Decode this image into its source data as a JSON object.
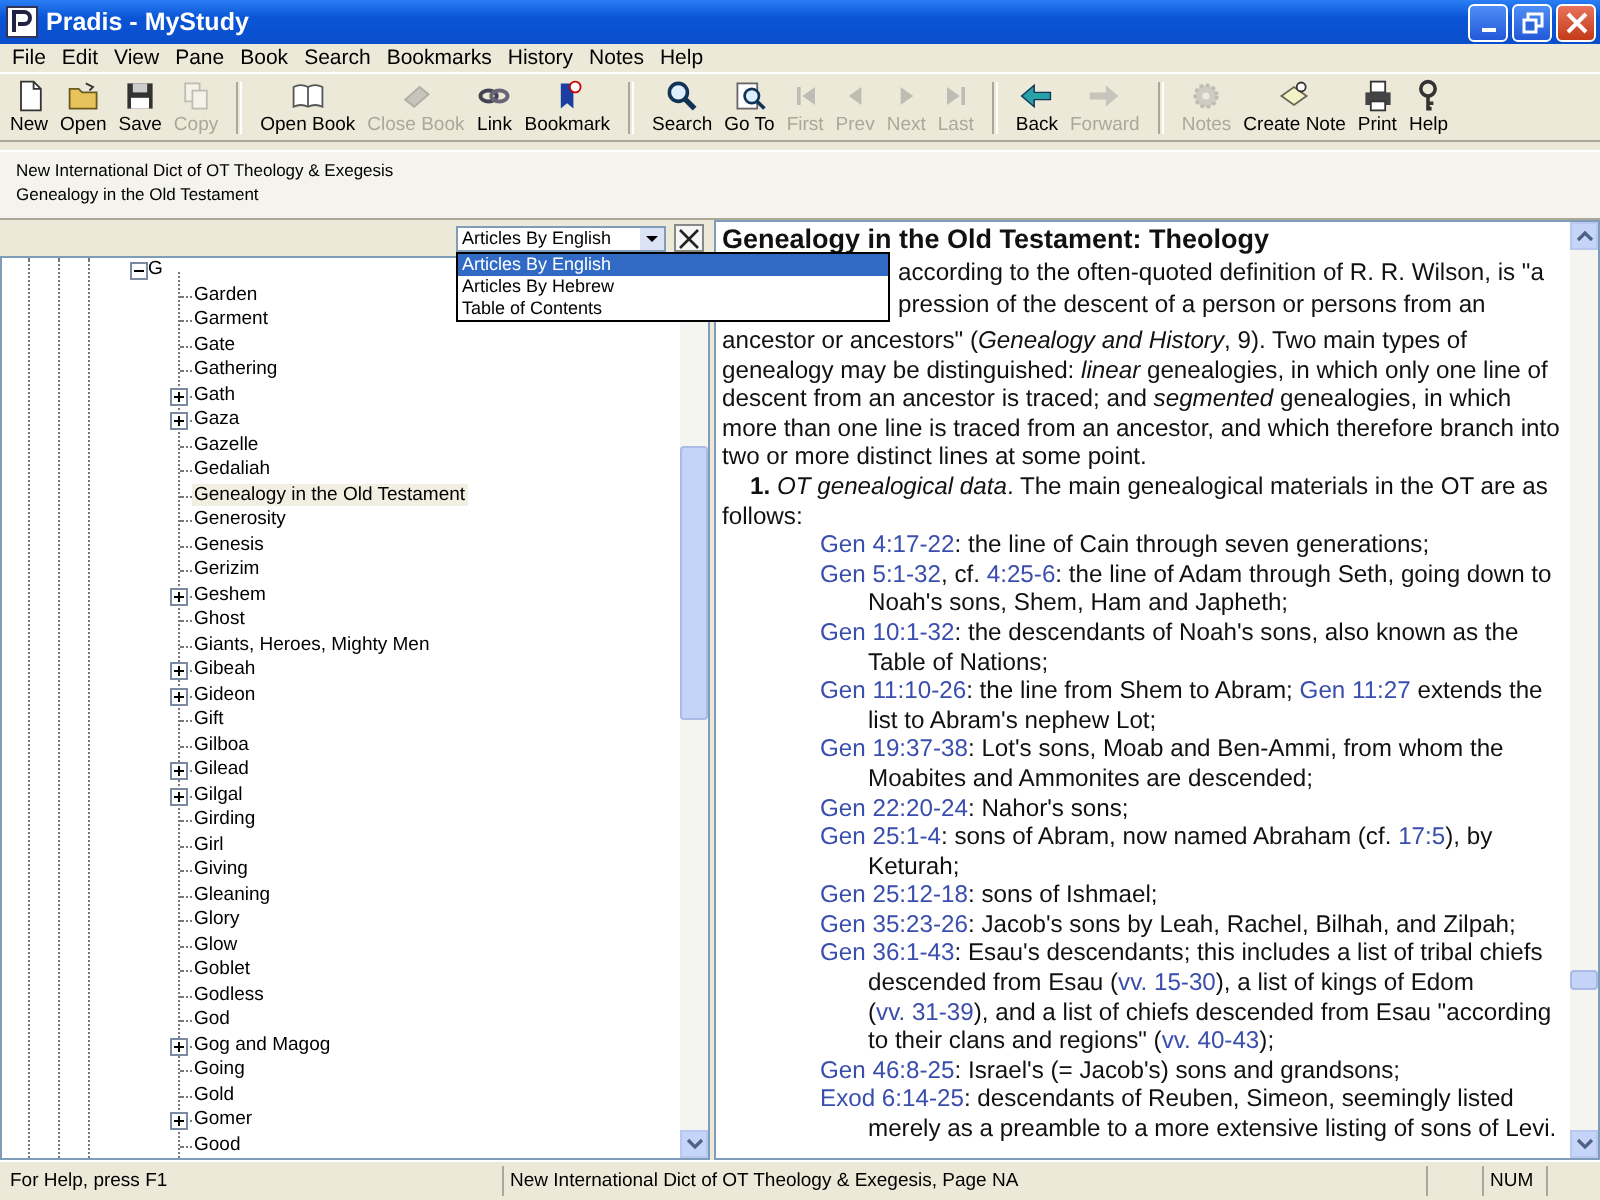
{
  "window": {
    "title": "Pradis - MyStudy"
  },
  "menu": [
    "File",
    "Edit",
    "View",
    "Pane",
    "Book",
    "Search",
    "Bookmarks",
    "History",
    "Notes",
    "Help"
  ],
  "toolbar": [
    [
      {
        "label": "New",
        "disabled": false
      },
      {
        "label": "Open",
        "disabled": false
      },
      {
        "label": "Save",
        "disabled": false
      },
      {
        "label": "Copy",
        "disabled": true
      }
    ],
    [
      {
        "label": "Open Book",
        "disabled": false
      },
      {
        "label": "Close Book",
        "disabled": true
      },
      {
        "label": "Link",
        "disabled": false
      },
      {
        "label": "Bookmark",
        "disabled": false
      }
    ],
    [
      {
        "label": "Search",
        "disabled": false
      },
      {
        "label": "Go To",
        "disabled": false
      },
      {
        "label": "First",
        "disabled": true
      },
      {
        "label": "Prev",
        "disabled": true
      },
      {
        "label": "Next",
        "disabled": true
      },
      {
        "label": "Last",
        "disabled": true
      }
    ],
    [
      {
        "label": "Back",
        "disabled": false
      },
      {
        "label": "Forward",
        "disabled": true
      }
    ],
    [
      {
        "label": "Notes",
        "disabled": true
      },
      {
        "label": "Create Note",
        "disabled": false
      },
      {
        "label": "Print",
        "disabled": false
      },
      {
        "label": "Help",
        "disabled": false
      }
    ]
  ],
  "header": {
    "book": "New International Dict of OT Theology & Exegesis",
    "article": "Genealogy in the Old Testament"
  },
  "index_pane": {
    "view_select": {
      "value": "Articles By English",
      "expanded": true,
      "options": [
        {
          "label": "Articles By English",
          "selected": true
        },
        {
          "label": "Articles By Hebrew",
          "selected": false
        },
        {
          "label": "Table of Contents",
          "selected": false
        }
      ]
    },
    "tree": [
      {
        "label": "G",
        "expanded": true,
        "children": [
          {
            "label": "Garden",
            "kind": "leaf",
            "selected": false
          },
          {
            "label": "Garment",
            "kind": "leaf",
            "selected": false
          },
          {
            "label": "Gate",
            "kind": "leaf",
            "selected": false
          },
          {
            "label": "Gathering",
            "kind": "leaf",
            "selected": false
          },
          {
            "label": "Gath",
            "kind": "branch",
            "selected": false
          },
          {
            "label": "Gaza",
            "kind": "branch",
            "selected": false
          },
          {
            "label": "Gazelle",
            "kind": "leaf",
            "selected": false
          },
          {
            "label": "Gedaliah",
            "kind": "leaf",
            "selected": false
          },
          {
            "label": "Genealogy in the Old Testament",
            "kind": "leaf",
            "selected": true
          },
          {
            "label": "Generosity",
            "kind": "leaf",
            "selected": false
          },
          {
            "label": "Genesis",
            "kind": "leaf",
            "selected": false
          },
          {
            "label": "Gerizim",
            "kind": "leaf",
            "selected": false
          },
          {
            "label": "Geshem",
            "kind": "branch",
            "selected": false
          },
          {
            "label": "Ghost",
            "kind": "leaf",
            "selected": false
          },
          {
            "label": "Giants, Heroes, Mighty Men",
            "kind": "leaf",
            "selected": false
          },
          {
            "label": "Gibeah",
            "kind": "branch",
            "selected": false
          },
          {
            "label": "Gideon",
            "kind": "branch",
            "selected": false
          },
          {
            "label": "Gift",
            "kind": "leaf",
            "selected": false
          },
          {
            "label": "Gilboa",
            "kind": "leaf",
            "selected": false
          },
          {
            "label": "Gilead",
            "kind": "branch",
            "selected": false
          },
          {
            "label": "Gilgal",
            "kind": "branch",
            "selected": false
          },
          {
            "label": "Girding",
            "kind": "leaf",
            "selected": false
          },
          {
            "label": "Girl",
            "kind": "leaf",
            "selected": false
          },
          {
            "label": "Giving",
            "kind": "leaf",
            "selected": false
          },
          {
            "label": "Gleaning",
            "kind": "leaf",
            "selected": false
          },
          {
            "label": "Glory",
            "kind": "leaf",
            "selected": false
          },
          {
            "label": "Glow",
            "kind": "leaf",
            "selected": false
          },
          {
            "label": "Goblet",
            "kind": "leaf",
            "selected": false
          },
          {
            "label": "Godless",
            "kind": "leaf",
            "selected": false
          },
          {
            "label": "God",
            "kind": "leaf",
            "selected": false
          },
          {
            "label": "Gog and Magog",
            "kind": "branch",
            "selected": false
          },
          {
            "label": "Going",
            "kind": "leaf",
            "selected": false
          },
          {
            "label": "Gold",
            "kind": "leaf",
            "selected": false
          },
          {
            "label": "Gomer",
            "kind": "branch",
            "selected": false
          },
          {
            "label": "Good",
            "kind": "leaf",
            "selected": false
          }
        ]
      }
    ]
  },
  "article": {
    "title": "Genealogy in the Old Testament: Theology",
    "intro_visible_lines": [
      "according to the often-quoted definition of R. R. Wilson, is \"a",
      "pression of the descent of a person or persons from an"
    ],
    "intro_rest": "ancestor or ancestors\" (*Genealogy and History*, 9). Two main types of genealogy may be distinguished: *linear* genealogies, in which only one line of descent from an ancestor is traced; and *segmented* genealogies, in which more than one line is traced from an ancestor, and which therefore branch into two or more distinct lines at some point.",
    "section": "**1.** *OT genealogical data*. The main genealogical materials in the OT are as follows:",
    "references": [
      [
        {
          "kind": "ref",
          "text": "Gen 4:17-22"
        },
        {
          "kind": "text",
          "text": ": the line of Cain through seven generations;"
        }
      ],
      [
        {
          "kind": "ref",
          "text": "Gen 5:1-32"
        },
        {
          "kind": "text",
          "text": ", cf. "
        },
        {
          "kind": "ref",
          "text": "4:25-6"
        },
        {
          "kind": "text",
          "text": ": the line of Adam through Seth, going down to Noah's sons, Shem, Ham and Japheth;"
        }
      ],
      [
        {
          "kind": "ref",
          "text": "Gen 10:1-32"
        },
        {
          "kind": "text",
          "text": ": the descendants of Noah's sons, also known as the Table of Nations;"
        }
      ],
      [
        {
          "kind": "ref",
          "text": "Gen 11:10-26"
        },
        {
          "kind": "text",
          "text": ": the line from Shem to Abram; "
        },
        {
          "kind": "ref",
          "text": "Gen 11:27"
        },
        {
          "kind": "text",
          "text": " extends the list to Abram's nephew Lot;"
        }
      ],
      [
        {
          "kind": "ref",
          "text": "Gen 19:37-38"
        },
        {
          "kind": "text",
          "text": ": Lot's sons, Moab and Ben-Ammi, from whom the Moabites and Ammonites are descended;"
        }
      ],
      [
        {
          "kind": "ref",
          "text": "Gen 22:20-24"
        },
        {
          "kind": "text",
          "text": ": Nahor's sons;"
        }
      ],
      [
        {
          "kind": "ref",
          "text": "Gen 25:1-4"
        },
        {
          "kind": "text",
          "text": ": sons of Abram, now named Abraham (cf. "
        },
        {
          "kind": "ref",
          "text": "17:5"
        },
        {
          "kind": "text",
          "text": "), by Keturah;"
        }
      ],
      [
        {
          "kind": "ref",
          "text": "Gen 25:12-18"
        },
        {
          "kind": "text",
          "text": ": sons of Ishmael;"
        }
      ],
      [
        {
          "kind": "ref",
          "text": "Gen 35:23-26"
        },
        {
          "kind": "text",
          "text": ": Jacob's sons by Leah, Rachel, Bilhah, and Zilpah;"
        }
      ],
      [
        {
          "kind": "ref",
          "text": "Gen 36:1-43"
        },
        {
          "kind": "text",
          "text": ": Esau's descendants; this includes a list of tribal chiefs descended from Esau ("
        },
        {
          "kind": "ref",
          "text": "vv. 15-30"
        },
        {
          "kind": "text",
          "text": "), a list of kings of Edom ("
        },
        {
          "kind": "ref",
          "text": "vv. 31-39"
        },
        {
          "kind": "text",
          "text": "), and a list of chiefs descended from Esau \"according to their clans and regions\" ("
        },
        {
          "kind": "ref",
          "text": "vv. 40-43"
        },
        {
          "kind": "text",
          "text": ");"
        }
      ],
      [
        {
          "kind": "ref",
          "text": "Gen 46:8-25"
        },
        {
          "kind": "text",
          "text": ": Israel's (= Jacob's) sons and grandsons;"
        }
      ],
      [
        {
          "kind": "ref",
          "text": "Exod 6:14-25"
        },
        {
          "kind": "text",
          "text": ": descendants of Reuben, Simeon, seemingly listed merely as a preamble to a more extensive listing of sons of Levi."
        }
      ]
    ]
  },
  "status_bar": {
    "help": "For Help, press F1",
    "location": "New International Dict of OT Theology & Exegesis, Page NA",
    "num_lock": "NUM"
  }
}
